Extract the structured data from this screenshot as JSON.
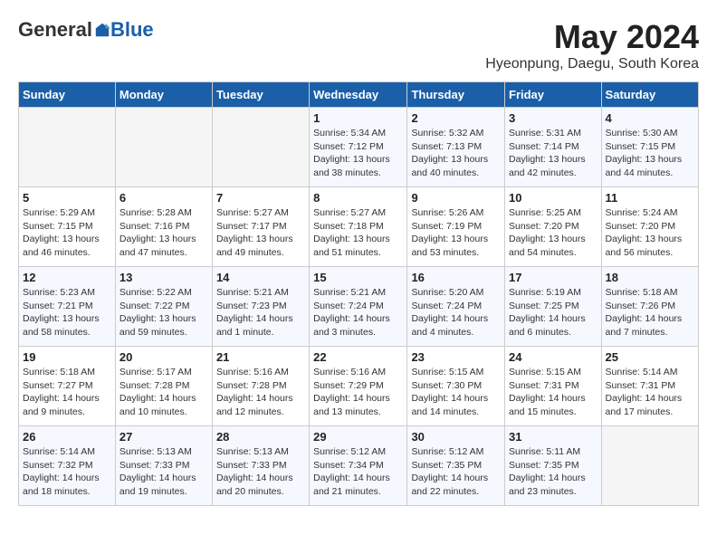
{
  "header": {
    "logo_general": "General",
    "logo_blue": "Blue",
    "title": "May 2024",
    "subtitle": "Hyeonpung, Daegu, South Korea"
  },
  "days_of_week": [
    "Sunday",
    "Monday",
    "Tuesday",
    "Wednesday",
    "Thursday",
    "Friday",
    "Saturday"
  ],
  "weeks": [
    [
      {
        "day": "",
        "info": ""
      },
      {
        "day": "",
        "info": ""
      },
      {
        "day": "",
        "info": ""
      },
      {
        "day": "1",
        "info": "Sunrise: 5:34 AM\nSunset: 7:12 PM\nDaylight: 13 hours\nand 38 minutes."
      },
      {
        "day": "2",
        "info": "Sunrise: 5:32 AM\nSunset: 7:13 PM\nDaylight: 13 hours\nand 40 minutes."
      },
      {
        "day": "3",
        "info": "Sunrise: 5:31 AM\nSunset: 7:14 PM\nDaylight: 13 hours\nand 42 minutes."
      },
      {
        "day": "4",
        "info": "Sunrise: 5:30 AM\nSunset: 7:15 PM\nDaylight: 13 hours\nand 44 minutes."
      }
    ],
    [
      {
        "day": "5",
        "info": "Sunrise: 5:29 AM\nSunset: 7:15 PM\nDaylight: 13 hours\nand 46 minutes."
      },
      {
        "day": "6",
        "info": "Sunrise: 5:28 AM\nSunset: 7:16 PM\nDaylight: 13 hours\nand 47 minutes."
      },
      {
        "day": "7",
        "info": "Sunrise: 5:27 AM\nSunset: 7:17 PM\nDaylight: 13 hours\nand 49 minutes."
      },
      {
        "day": "8",
        "info": "Sunrise: 5:27 AM\nSunset: 7:18 PM\nDaylight: 13 hours\nand 51 minutes."
      },
      {
        "day": "9",
        "info": "Sunrise: 5:26 AM\nSunset: 7:19 PM\nDaylight: 13 hours\nand 53 minutes."
      },
      {
        "day": "10",
        "info": "Sunrise: 5:25 AM\nSunset: 7:20 PM\nDaylight: 13 hours\nand 54 minutes."
      },
      {
        "day": "11",
        "info": "Sunrise: 5:24 AM\nSunset: 7:20 PM\nDaylight: 13 hours\nand 56 minutes."
      }
    ],
    [
      {
        "day": "12",
        "info": "Sunrise: 5:23 AM\nSunset: 7:21 PM\nDaylight: 13 hours\nand 58 minutes."
      },
      {
        "day": "13",
        "info": "Sunrise: 5:22 AM\nSunset: 7:22 PM\nDaylight: 13 hours\nand 59 minutes."
      },
      {
        "day": "14",
        "info": "Sunrise: 5:21 AM\nSunset: 7:23 PM\nDaylight: 14 hours\nand 1 minute."
      },
      {
        "day": "15",
        "info": "Sunrise: 5:21 AM\nSunset: 7:24 PM\nDaylight: 14 hours\nand 3 minutes."
      },
      {
        "day": "16",
        "info": "Sunrise: 5:20 AM\nSunset: 7:24 PM\nDaylight: 14 hours\nand 4 minutes."
      },
      {
        "day": "17",
        "info": "Sunrise: 5:19 AM\nSunset: 7:25 PM\nDaylight: 14 hours\nand 6 minutes."
      },
      {
        "day": "18",
        "info": "Sunrise: 5:18 AM\nSunset: 7:26 PM\nDaylight: 14 hours\nand 7 minutes."
      }
    ],
    [
      {
        "day": "19",
        "info": "Sunrise: 5:18 AM\nSunset: 7:27 PM\nDaylight: 14 hours\nand 9 minutes."
      },
      {
        "day": "20",
        "info": "Sunrise: 5:17 AM\nSunset: 7:28 PM\nDaylight: 14 hours\nand 10 minutes."
      },
      {
        "day": "21",
        "info": "Sunrise: 5:16 AM\nSunset: 7:28 PM\nDaylight: 14 hours\nand 12 minutes."
      },
      {
        "day": "22",
        "info": "Sunrise: 5:16 AM\nSunset: 7:29 PM\nDaylight: 14 hours\nand 13 minutes."
      },
      {
        "day": "23",
        "info": "Sunrise: 5:15 AM\nSunset: 7:30 PM\nDaylight: 14 hours\nand 14 minutes."
      },
      {
        "day": "24",
        "info": "Sunrise: 5:15 AM\nSunset: 7:31 PM\nDaylight: 14 hours\nand 15 minutes."
      },
      {
        "day": "25",
        "info": "Sunrise: 5:14 AM\nSunset: 7:31 PM\nDaylight: 14 hours\nand 17 minutes."
      }
    ],
    [
      {
        "day": "26",
        "info": "Sunrise: 5:14 AM\nSunset: 7:32 PM\nDaylight: 14 hours\nand 18 minutes."
      },
      {
        "day": "27",
        "info": "Sunrise: 5:13 AM\nSunset: 7:33 PM\nDaylight: 14 hours\nand 19 minutes."
      },
      {
        "day": "28",
        "info": "Sunrise: 5:13 AM\nSunset: 7:33 PM\nDaylight: 14 hours\nand 20 minutes."
      },
      {
        "day": "29",
        "info": "Sunrise: 5:12 AM\nSunset: 7:34 PM\nDaylight: 14 hours\nand 21 minutes."
      },
      {
        "day": "30",
        "info": "Sunrise: 5:12 AM\nSunset: 7:35 PM\nDaylight: 14 hours\nand 22 minutes."
      },
      {
        "day": "31",
        "info": "Sunrise: 5:11 AM\nSunset: 7:35 PM\nDaylight: 14 hours\nand 23 minutes."
      },
      {
        "day": "",
        "info": ""
      }
    ]
  ]
}
